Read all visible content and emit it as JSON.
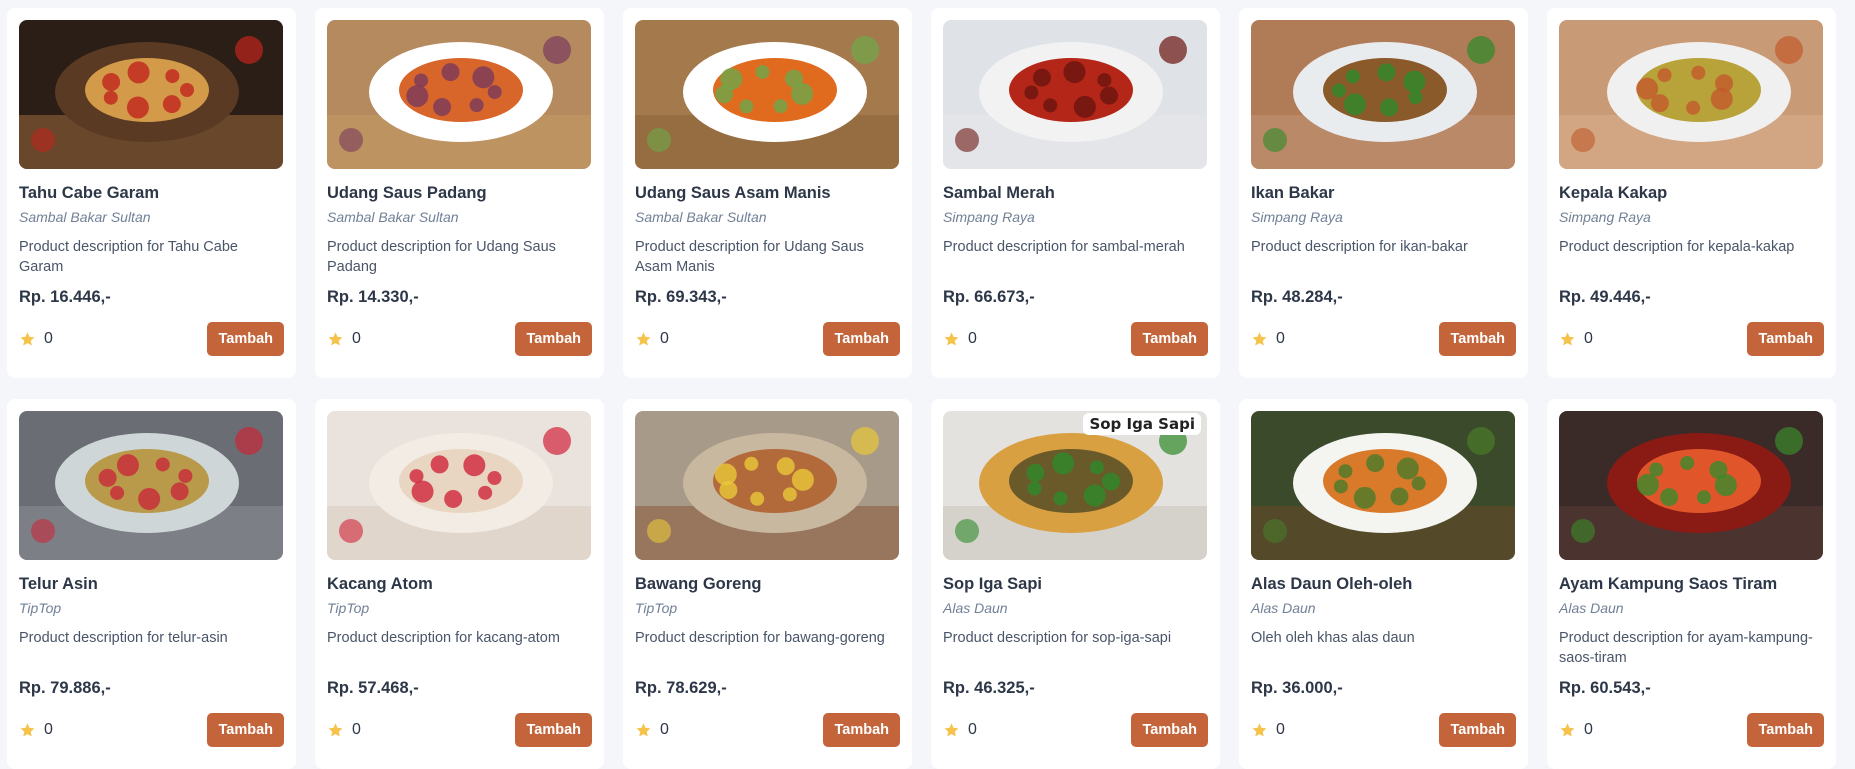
{
  "products": [
    {
      "name": "Tahu Cabe Garam",
      "seller": "Sambal Bakar Sultan",
      "description": "Product description for Tahu Cabe Garam",
      "price": "Rp. 16.446,-",
      "rating": "0",
      "button_label": "Tambah",
      "image": {
        "bg": "#2a1e16",
        "plate": "#5a3a22",
        "food": "#d39a4a",
        "accent": "#c0241c",
        "board": "#9a6a3c"
      }
    },
    {
      "name": "Udang Saus Padang",
      "seller": "Sambal Bakar Sultan",
      "description": "Product description for Udang Saus Padang",
      "price": "Rp. 14.330,-",
      "rating": "0",
      "button_label": "Tambah",
      "image": {
        "bg": "#b58a5e",
        "plate": "#ffffff",
        "food": "#d8652a",
        "accent": "#7a3a5c",
        "board": "#c49a66"
      }
    },
    {
      "name": "Udang Saus Asam Manis",
      "seller": "Sambal Bakar Sultan",
      "description": "Product description for Udang Saus Asam Manis",
      "price": "Rp. 69.343,-",
      "rating": "0",
      "button_label": "Tambah",
      "image": {
        "bg": "#a47a4c",
        "plate": "#ffffff",
        "food": "#e06a1e",
        "accent": "#6ea84a",
        "board": "#8a6236"
      }
    },
    {
      "name": "Sambal Merah",
      "seller": "Simpang Raya",
      "description": "Product description for sambal-merah",
      "price": "Rp. 66.673,-",
      "rating": "0",
      "button_label": "Tambah",
      "image": {
        "bg": "#dfe3e8",
        "plate": "#f2f2f2",
        "food": "#b32618",
        "accent": "#6a1410",
        "board": "#e8e8e8"
      }
    },
    {
      "name": "Ikan Bakar",
      "seller": "Simpang Raya",
      "description": "Product description for ikan-bakar",
      "price": "Rp. 48.284,-",
      "rating": "0",
      "button_label": "Tambah",
      "image": {
        "bg": "#b07c58",
        "plate": "#e9ecef",
        "food": "#8a5a2a",
        "accent": "#2e8a2a",
        "board": "#c29474"
      }
    },
    {
      "name": "Kepala Kakap",
      "seller": "Simpang Raya",
      "description": "Product description for kepala-kakap",
      "price": "Rp. 49.446,-",
      "rating": "0",
      "button_label": "Tambah",
      "image": {
        "bg": "#c99a76",
        "plate": "#f0f0f0",
        "food": "#b8a23a",
        "accent": "#c25a2a",
        "board": "#d8b08e"
      }
    },
    {
      "name": "Telur Asin",
      "seller": "TipTop",
      "description": "Product description for telur-asin",
      "price": "Rp. 79.886,-",
      "rating": "0",
      "button_label": "Tambah",
      "image": {
        "bg": "#6a6e74",
        "plate": "#cfd6d8",
        "food": "#b89a4a",
        "accent": "#c8283a",
        "board": "#8a8e94"
      }
    },
    {
      "name": "Kacang Atom",
      "seller": "TipTop",
      "description": "Product description for kacang-atom",
      "price": "Rp. 57.468,-",
      "rating": "0",
      "button_label": "Tambah",
      "image": {
        "bg": "#eae2dc",
        "plate": "#f3ece4",
        "food": "#e8d6c2",
        "accent": "#d0243a",
        "board": "#d8ccc0"
      }
    },
    {
      "name": "Bawang Goreng",
      "seller": "TipTop",
      "description": "Product description for bawang-goreng",
      "price": "Rp. 78.629,-",
      "rating": "0",
      "button_label": "Tambah",
      "image": {
        "bg": "#a89a88",
        "plate": "#c8b8a0",
        "food": "#b26a3a",
        "accent": "#e8c83a",
        "board": "#8a5a3a"
      }
    },
    {
      "name": "Sop Iga Sapi",
      "seller": "Alas Daun",
      "description": "Product description for sop-iga-sapi",
      "price": "Rp. 46.325,-",
      "rating": "0",
      "button_label": "Tambah",
      "image": {
        "bg": "#e4e2de",
        "plate": "#d8a040",
        "food": "#6a5a2a",
        "accent": "#2e8a2a",
        "board": "#c8c4bc"
      }
    },
    {
      "name": "Alas Daun Oleh-oleh",
      "seller": "Alas Daun",
      "description": "Oleh oleh khas alas daun",
      "price": "Rp. 36.000,-",
      "rating": "0",
      "button_label": "Tambah",
      "image": {
        "bg": "#3a4a2a",
        "plate": "#f4f4f0",
        "food": "#d87a2a",
        "accent": "#4a7a2a",
        "board": "#6a4a2a"
      }
    },
    {
      "name": "Ayam Kampung Saos Tiram",
      "seller": "Alas Daun",
      "description": "Product description for ayam-kampung-saos-tiram",
      "price": "Rp. 60.543,-",
      "rating": "0",
      "button_label": "Tambah",
      "image": {
        "bg": "#3a2a28",
        "plate": "#8a1a14",
        "food": "#e0562a",
        "accent": "#3a8a2a",
        "board": "#5a3a34"
      }
    }
  ],
  "image_labels": {
    "sop_iga_sapi_overlay": "Sop Iga Sapi"
  },
  "colors": {
    "accent": "#c4643a",
    "star": "#f6c34a",
    "card_bg": "#ffffff",
    "page_bg": "#f4f6f9"
  },
  "icons": {
    "rating": "star-icon"
  }
}
